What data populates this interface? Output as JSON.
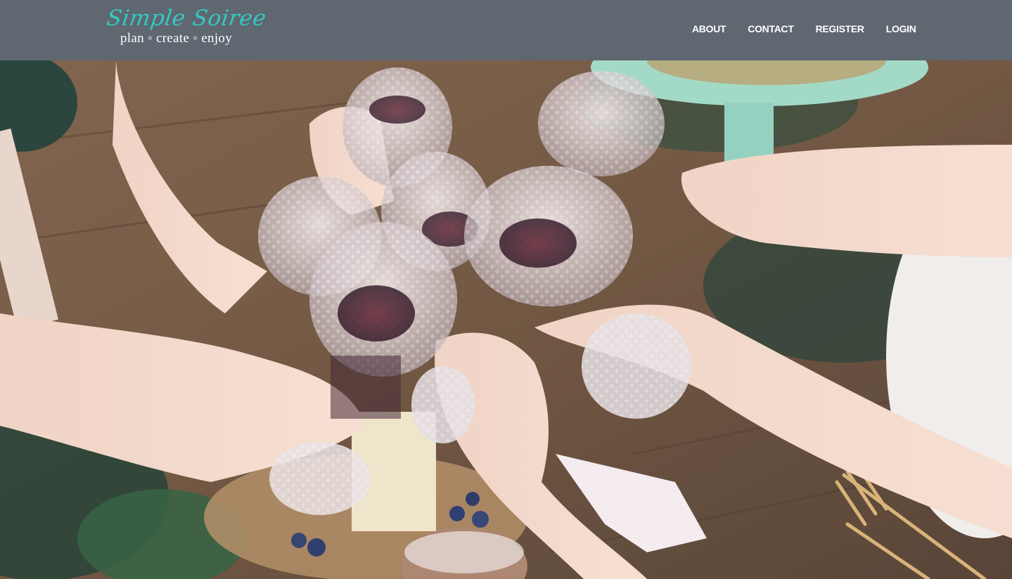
{
  "header": {
    "brand_name": "Simple Soiree",
    "tagline": "plan ◦ create ◦ enjoy",
    "brand_color": "#34c9c2",
    "background_color": "#5f6771"
  },
  "nav": {
    "items": [
      {
        "label": "ABOUT"
      },
      {
        "label": "CONTACT"
      },
      {
        "label": "REGISTER"
      },
      {
        "label": "LOGIN"
      }
    ]
  },
  "hero": {
    "description": "Hero photo: hands toasting with cut crystal wine glasses over a rustic wooden table"
  }
}
